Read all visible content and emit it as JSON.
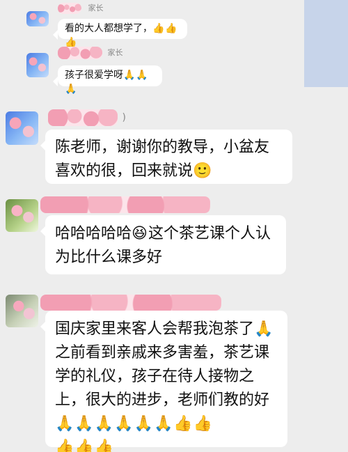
{
  "messages": [
    {
      "role": "parent",
      "tag": "家长",
      "text": "看的大人都想学了，",
      "emoji": "👍👍👍"
    },
    {
      "role": "parent",
      "tag": "家长",
      "text": "孩子很爱学呀",
      "emoji": "🙏🙏🙏"
    },
    {
      "name_suffix": ")",
      "text": "陈老师，谢谢你的教导，小盆友喜欢的很，回来就说",
      "emoji": "🙂"
    },
    {
      "text_before": "哈哈哈哈哈",
      "emoji": "😆",
      "text_after": "这个茶艺课个人认为比什么课多好"
    },
    {
      "text": "国庆家里来客人会帮我泡茶了",
      "emoji_1": "🙏",
      "text_2": "之前看到亲戚来多害羞，茶艺课学的礼仪，孩子在待人接物之上，很大的进步，老师们教的好",
      "emoji_2": "🙏🙏🙏🙏🙏🙏👍👍",
      "emoji_3": "👍👍👍"
    }
  ]
}
